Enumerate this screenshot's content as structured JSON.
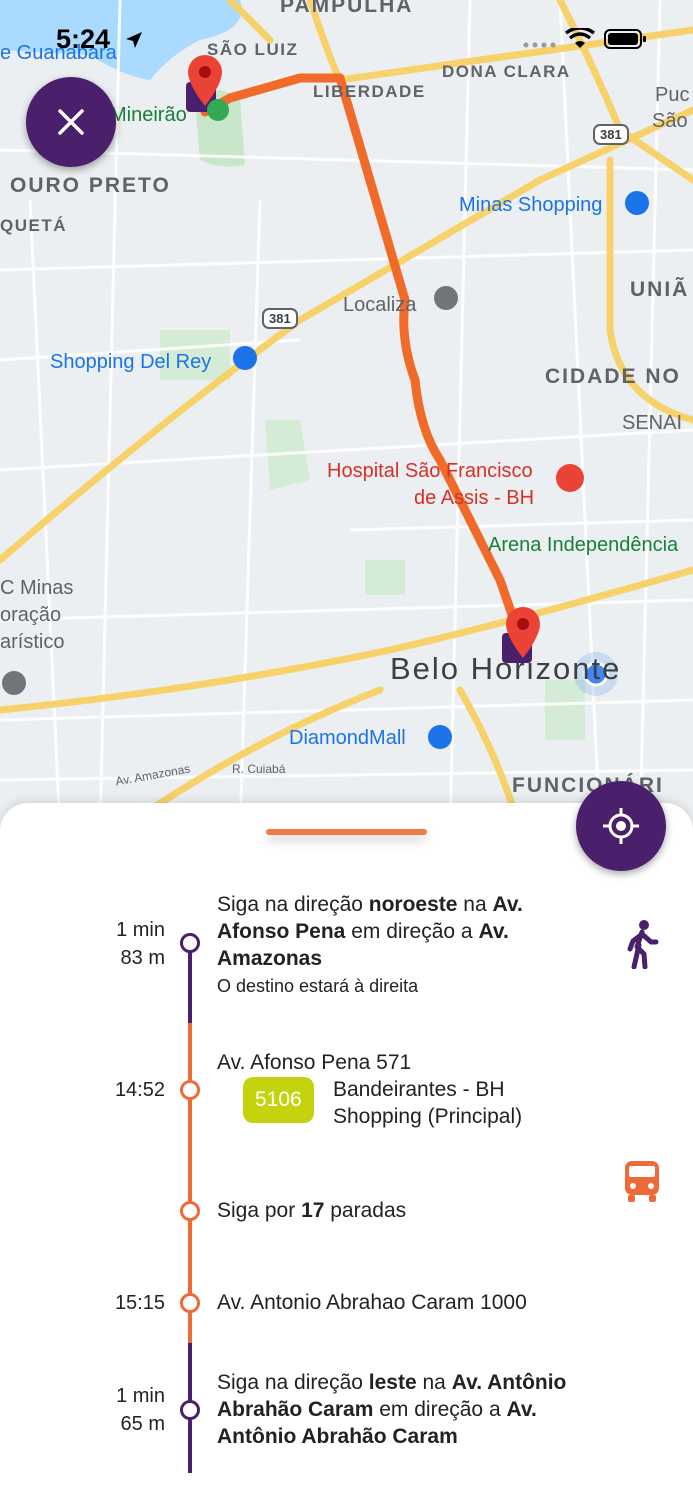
{
  "status_bar": {
    "time": "5:24"
  },
  "map": {
    "districts": [
      "PAMPULHA",
      "SÃO LUIZ",
      "DONA CLARA",
      "LIBERDADE",
      "OURO PRETO",
      "QUETÁ",
      "UNIÃ",
      "CIDADE NO",
      "FUNCIONÁRI"
    ],
    "pois": {
      "guanabara": "e Guanabara",
      "mineirao": "Mineirão",
      "minas_shopping": "Minas Shopping",
      "localiza": "Localiza",
      "shopping_del_rey": "Shopping Del Rey",
      "hospital_line1": "Hospital São Francisco",
      "hospital_line2": "de Assis - BH",
      "arena": "Arena Independência",
      "senai": "SENAI",
      "diamond": "DiamondMall",
      "c_minas": "C Minas",
      "oracao": "oração",
      "aristico": "arístico",
      "pu": "Puc",
      "sao": "São"
    },
    "city": "Belo Horizonte",
    "highway": "381",
    "streets": {
      "amazonas": "Av. Amazonas",
      "cuiaba": "R. Cuiabá"
    }
  },
  "colors": {
    "primary": "#4a1f6b",
    "accent": "#ee6a37",
    "route": "#f06a2a",
    "badge": "#c5d20e"
  },
  "icons": {
    "close": "close-icon",
    "locate": "my-location-icon",
    "walk": "walk-icon",
    "bus": "bus-icon"
  },
  "steps": {
    "walk1": {
      "duration": "1 min",
      "distance": "83 m",
      "t1": "Siga na direção ",
      "b1": "noroeste",
      "t2": " na ",
      "b2": "Av.",
      "b3": "Afonso Pena",
      "t3": " em direção a ",
      "b4": "Av.",
      "b5": "Amazonas",
      "note": "O destino estará à direita"
    },
    "board": {
      "time": "14:52",
      "stop": "Av. Afonso Pena 571",
      "line": "5106",
      "dest_line1": "Bandeirantes - BH",
      "dest_line2": "Shopping (Principal)"
    },
    "ride": {
      "t1": "Siga por ",
      "b1": "17",
      "t2": " paradas"
    },
    "alight": {
      "time": "15:15",
      "stop": "Av. Antonio Abrahao Caram 1000"
    },
    "walk2": {
      "duration": "1 min",
      "distance": "65 m",
      "t1": "Siga na direção ",
      "b1": "leste",
      "t2": " na ",
      "b2": "Av. Antônio",
      "b3": "Abrahão Caram",
      "t3": " em direção a ",
      "b4": "Av.",
      "b5": "Antônio Abrahão Caram"
    }
  }
}
